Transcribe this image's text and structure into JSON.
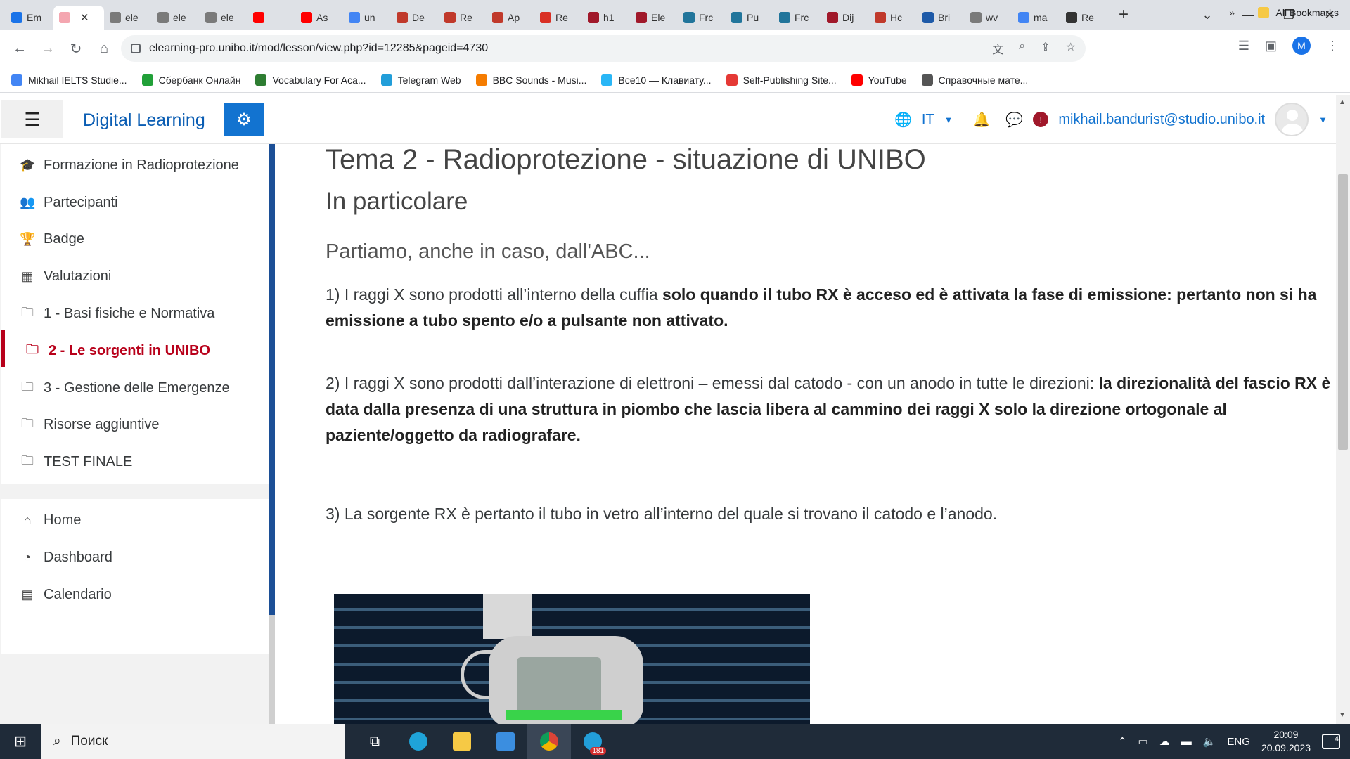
{
  "browser": {
    "tabs": [
      {
        "label": "Em",
        "color": "#1a73e8"
      },
      {
        "label": "",
        "color": "#f4a6b0",
        "active": true
      },
      {
        "label": "ele",
        "color": "#7a7a7a"
      },
      {
        "label": "ele",
        "color": "#7a7a7a"
      },
      {
        "label": "ele",
        "color": "#7a7a7a"
      },
      {
        "label": "",
        "color": "#ff0000"
      },
      {
        "label": "As",
        "color": "#ff0000"
      },
      {
        "label": "un",
        "color": "#4285f4"
      },
      {
        "label": "De",
        "color": "#c0392b"
      },
      {
        "label": "Re",
        "color": "#c0392b"
      },
      {
        "label": "Ap",
        "color": "#c0392b"
      },
      {
        "label": "Re",
        "color": "#d93025"
      },
      {
        "label": "h1",
        "color": "#a0182a"
      },
      {
        "label": "Ele",
        "color": "#a0182a"
      },
      {
        "label": "Frc",
        "color": "#21759b"
      },
      {
        "label": "Pu",
        "color": "#21759b"
      },
      {
        "label": "Frc",
        "color": "#21759b"
      },
      {
        "label": "Dij",
        "color": "#a0182a"
      },
      {
        "label": "Hc",
        "color": "#c0392b"
      },
      {
        "label": "Bri",
        "color": "#1e5aa8"
      },
      {
        "label": "wv",
        "color": "#7a7a7a"
      },
      {
        "label": "ma",
        "color": "#4285f4"
      },
      {
        "label": "Re",
        "color": "#333333"
      }
    ],
    "close_glyph": "✕",
    "new_tab_glyph": "+",
    "url": "elearning-pro.unibo.it/mod/lesson/view.php?id=12285&pageid=4730",
    "profile_initial": "M",
    "bookmarks": [
      {
        "label": "Mikhail IELTS Studie...",
        "color": "#4285f4"
      },
      {
        "label": "Сбербанк Онлайн",
        "color": "#21a038"
      },
      {
        "label": "Vocabulary For Aca...",
        "color": "#2e7d32"
      },
      {
        "label": "Telegram Web",
        "color": "#229ed9"
      },
      {
        "label": "BBC Sounds - Musi...",
        "color": "#f57c00"
      },
      {
        "label": "Все10 — Клавиату...",
        "color": "#29b6f6"
      },
      {
        "label": "Self-Publishing Site...",
        "color": "#e53935"
      },
      {
        "label": "YouTube",
        "color": "#ff0000"
      },
      {
        "label": "Справочные мате...",
        "color": "#555555"
      }
    ],
    "bookmarks_more": "»",
    "all_bookmarks": "All Bookmarks"
  },
  "navbar": {
    "brand": "Digital Learning",
    "lang": "IT",
    "user_email": "mikhail.bandurist@studio.unibo.it"
  },
  "sidebar": {
    "items": [
      {
        "label": "Formazione in Radioprotezione",
        "icon": "graduation-cap-icon",
        "glyph": "🎓"
      },
      {
        "label": "Partecipanti",
        "icon": "users-icon",
        "glyph": "👥"
      },
      {
        "label": "Badge",
        "icon": "trophy-icon",
        "glyph": "🏆"
      },
      {
        "label": "Valutazioni",
        "icon": "table-icon",
        "glyph": "▦"
      },
      {
        "label": "1 - Basi fisiche e Normativa",
        "icon": "folder-icon",
        "glyph": "🗀"
      },
      {
        "label": "2 - Le sorgenti in UNIBO",
        "icon": "folder-icon",
        "glyph": "🗀",
        "active": true
      },
      {
        "label": "3 - Gestione delle Emergenze",
        "icon": "folder-icon",
        "glyph": "🗀"
      },
      {
        "label": "Risorse aggiuntive",
        "icon": "folder-icon",
        "glyph": "🗀"
      },
      {
        "label": "TEST FINALE",
        "icon": "folder-icon",
        "glyph": "🗀"
      }
    ],
    "items2": [
      {
        "label": "Home",
        "icon": "home-icon",
        "glyph": "⌂"
      },
      {
        "label": "Dashboard",
        "icon": "dashboard-icon",
        "glyph": "◔"
      },
      {
        "label": "Calendario",
        "icon": "calendar-icon",
        "glyph": "▤"
      }
    ]
  },
  "content": {
    "title": "Tema 2 - Radioprotezione - situazione di UNIBO",
    "subtitle": "In particolare",
    "lead": "Partiamo, anche in caso, dall'ABC...",
    "p1_plain": "1) I raggi X sono prodotti all’interno della cuffia ",
    "p1_bold": "solo quando il tubo RX è acceso ed è attivata la fase di emissione: pertanto non si ha emissione a tubo spento e/o a pulsante non attivato.",
    "p2_plain": "2) I raggi X sono prodotti dall’interazione di elettroni – emessi dal catodo - con un anodo in tutte le direzioni: ",
    "p2_bold": "la direzionalità del fascio RX è data dalla presenza di una struttura in piombo che lascia libera al cammino dei raggi X solo la direzione ortogonale al paziente/oggetto da radiografare.",
    "p3": "3) La sorgente RX è pertanto il tubo in vetro all’interno del quale si trovano il catodo e l’anodo."
  },
  "taskbar": {
    "search_placeholder": "Поиск",
    "lang": "ENG",
    "time": "20:09",
    "date": "20.09.2023",
    "telegram_badge": "181",
    "notifications": "4"
  }
}
